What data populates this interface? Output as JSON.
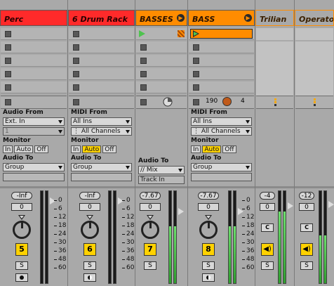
{
  "tracks": [
    {
      "name": "Perc",
      "type": "audio",
      "color": "#ff2a2a",
      "input_type": "Ext. In",
      "input_channel": "1",
      "monitor": "Off",
      "audio_to": "Group",
      "volume": "-Inf",
      "pan": "0",
      "number": "5",
      "solo": "S"
    },
    {
      "name": "6 Drum Rack",
      "type": "midi",
      "color": "#ff2a2a",
      "input_type": "All Ins",
      "input_channel": "All Channels",
      "monitor": "Auto",
      "audio_to": "Group",
      "volume": "-Inf",
      "pan": "0",
      "number": "6",
      "solo": "S"
    },
    {
      "name": "BASSES",
      "type": "group",
      "color": "#ff8c00",
      "audio_to": "// Mix",
      "audio_to_sub": "Track In",
      "volume": "-7.67",
      "pan": "0",
      "number": "7",
      "solo": "S"
    },
    {
      "name": "BASS",
      "type": "midi",
      "color": "#ff8c00",
      "input_type": "All Ins",
      "input_channel": "All Channels",
      "monitor": "Auto",
      "audio_to": "Group",
      "volume": "-7.67",
      "pan": "0",
      "number": "8",
      "solo": "S",
      "tempo": "190",
      "dial_value": "4"
    },
    {
      "name": "Trilian",
      "type": "chain",
      "color": "#ff8c00",
      "volume": "-4",
      "pan": "0",
      "mute_label": "C",
      "solo": "S"
    },
    {
      "name": "Operator",
      "type": "chain",
      "color": "#ff8c00",
      "volume": "-12",
      "pan": "0",
      "mute_label": "C",
      "solo": "S"
    }
  ],
  "labels": {
    "audio_from": "Audio From",
    "midi_from": "MIDI From",
    "monitor": "Monitor",
    "audio_to": "Audio To",
    "mon_in": "In",
    "mon_auto": "Auto",
    "mon_off": "Off"
  },
  "meter_scale": [
    "0",
    "6",
    "12",
    "18",
    "24",
    "30",
    "36",
    "48",
    "60"
  ],
  "meter_levels": {
    "BASSES": 0.62,
    "BASS": 0.62,
    "Trilian": 0.78,
    "Operator": 0.52
  }
}
